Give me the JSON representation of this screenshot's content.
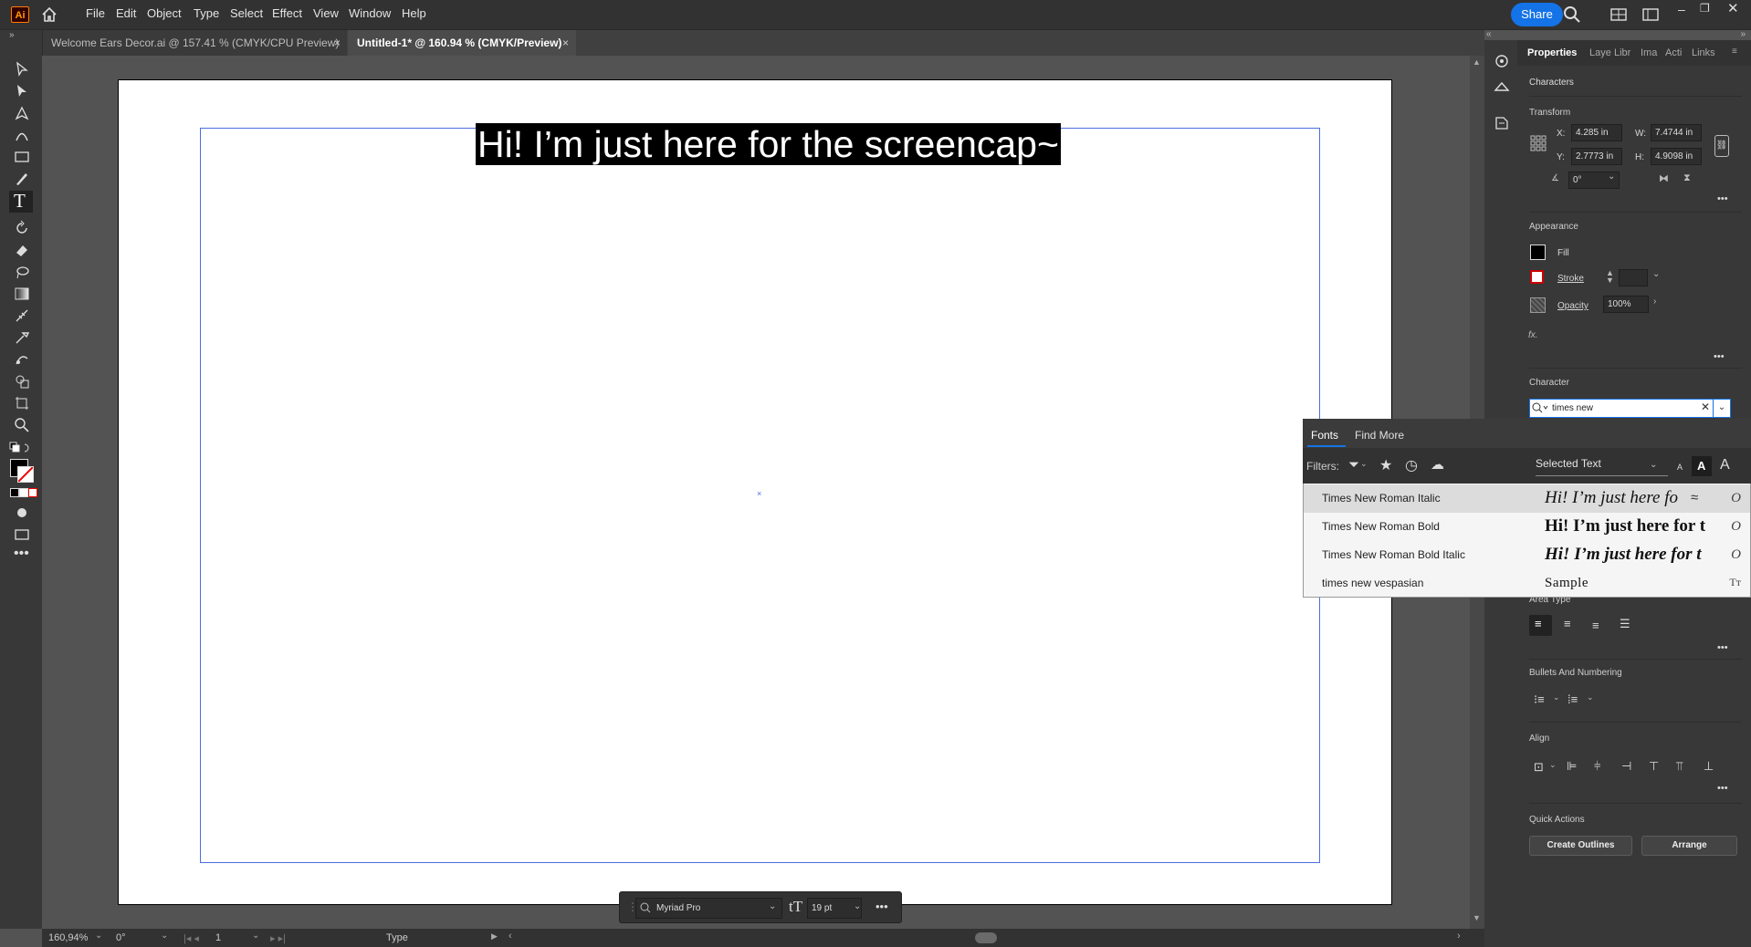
{
  "app": {
    "logo": "Ai",
    "home_icon": "home-icon"
  },
  "menu": [
    "File",
    "Edit",
    "Object",
    "Type",
    "Select",
    "Effect",
    "View",
    "Window",
    "Help"
  ],
  "header": {
    "share_label": "Share"
  },
  "tabs": [
    {
      "label": "Welcome Ears Decor.ai @ 157.41 % (CMYK/CPU Preview)",
      "close": "×"
    },
    {
      "label": "Untitled-1* @ 160.94 % (CMYK/Preview)",
      "close": "×"
    }
  ],
  "canvas": {
    "selected_text": "Hi! I’m just here for the screencap~"
  },
  "statusbar": {
    "zoom": "160,94%",
    "rotation": "0°",
    "artboard": "1",
    "tool": "Type"
  },
  "contextbar": {
    "font": "Myriad Pro",
    "size": "19 pt"
  },
  "panel_tabs": [
    "Properties",
    "Laye",
    "Libr",
    "Ima",
    "Acti",
    "Links"
  ],
  "properties": {
    "selection": "Characters",
    "transform": {
      "title": "Transform",
      "x_label": "X:",
      "x": "4.285 in",
      "y_label": "Y:",
      "y": "2.7773 in",
      "w_label": "W:",
      "w": "7.4744 in",
      "h_label": "H:",
      "h": "4.9098 in",
      "angle": "0°"
    },
    "appearance": {
      "title": "Appearance",
      "fill": "Fill",
      "stroke": "Stroke",
      "opacity_label": "Opacity",
      "opacity": "100%",
      "fx": "fx."
    },
    "character": {
      "title": "Character",
      "search_value": "times new"
    },
    "area_type": {
      "title": "Area Type"
    },
    "bullets": {
      "title": "Bullets And Numbering"
    },
    "align": {
      "title": "Align"
    },
    "quick_actions": {
      "title": "Quick Actions",
      "create_outlines": "Create Outlines",
      "arrange": "Arrange"
    }
  },
  "font_menu": {
    "tabs": [
      "Fonts",
      "Find More"
    ],
    "filters_label": "Filters:",
    "preview_select": "Selected Text",
    "size_icons": [
      "A",
      "A",
      "A"
    ],
    "fonts": [
      {
        "name": "Times New Roman Italic",
        "sample": "Hi! I’m just here fo",
        "glyph": "O"
      },
      {
        "name": "Times New Roman Bold",
        "sample": "Hi! I’m just here for t",
        "glyph": "O"
      },
      {
        "name": "Times New Roman Bold Italic",
        "sample": "Hi! I’m just here for t",
        "glyph": "O"
      },
      {
        "name": "times new vespasian",
        "sample": "Sample",
        "glyph": "Tт"
      }
    ]
  },
  "colors": {
    "accent": "#1473e6",
    "panel_bg": "#383838",
    "canvas_bg": "#535353",
    "frame": "#4a6ee0"
  }
}
